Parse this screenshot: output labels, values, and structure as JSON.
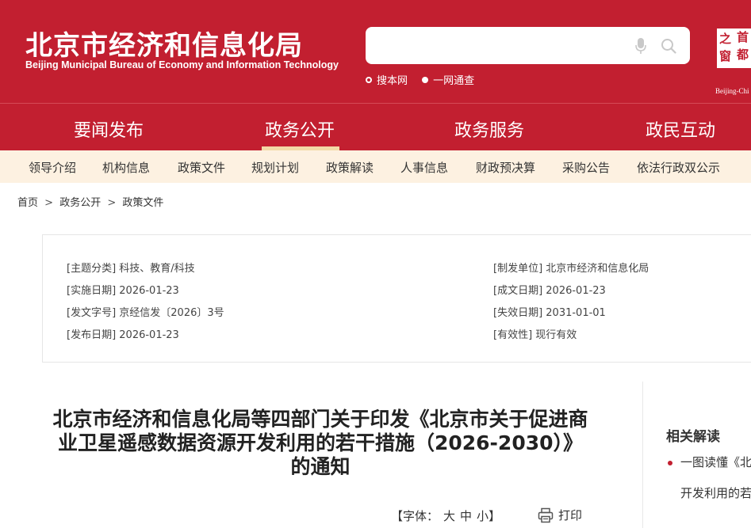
{
  "header": {
    "title": "北京市经济和信息化局",
    "subtitle": "Beijing Municipal Bureau of Economy and Information Technology",
    "search": {
      "value": "",
      "placeholder": ""
    },
    "scope": {
      "option1": "搜本网",
      "option2": "一网通查"
    },
    "badge": {
      "c1": "之",
      "c2": "首",
      "c3": "窗",
      "c4": "都",
      "caption": "Beijing-Chi"
    }
  },
  "main_nav": [
    "要闻发布",
    "政务公开",
    "政务服务",
    "政民互动"
  ],
  "sub_nav": [
    "领导介绍",
    "机构信息",
    "政策文件",
    "规划计划",
    "政策解读",
    "人事信息",
    "财政预决算",
    "采购公告",
    "依法行政双公示"
  ],
  "breadcrumb": {
    "home": "首页",
    "level1": "政务公开",
    "level2": "政策文件",
    "sep": ">"
  },
  "meta": {
    "topic": "[主题分类] 科技、教育/科技",
    "impl_date": "[实施日期] 2026-01-23",
    "doc_no": "[发文字号] 京经信发〔2026〕3号",
    "pub_date": "[发布日期] 2026-01-23",
    "issuer": "[制发单位] 北京市经济和信息化局",
    "written_date": "[成文日期] 2026-01-23",
    "expiry_date": "[失效日期] 2031-01-01",
    "validity": "[有效性] 现行有效"
  },
  "article": {
    "title_line1": "北京市经济和信息化局等四部门关于印发《北京市关于促进商",
    "title_line2": "业卫星遥感数据资源开发利用的若干措施（2026-2030）》",
    "title_line3": "的通知",
    "font_label": "【字体：",
    "font_large": "大",
    "font_medium": "中",
    "font_small": "小",
    "font_close": "】",
    "print": "打印"
  },
  "sidebar": {
    "title": "相关解读",
    "item1": "一图读懂《北",
    "item1_cont": "开发利用的若"
  },
  "colors": {
    "brand_red": "#c21f30",
    "subnav_bg": "#fdf1e1",
    "active_underline": "#f3d9a6"
  }
}
